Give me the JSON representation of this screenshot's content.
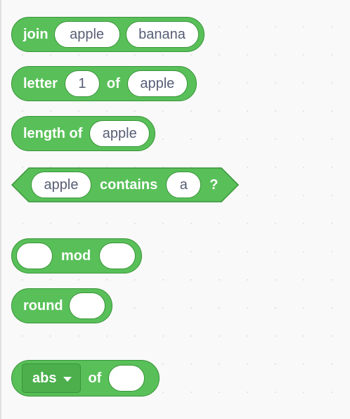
{
  "blocks": {
    "join": {
      "label": "join",
      "input1": "apple",
      "input2": "banana"
    },
    "letter": {
      "label": "letter",
      "index": "1",
      "of": "of",
      "word": "apple"
    },
    "length": {
      "label": "length of",
      "word": "apple"
    },
    "contains": {
      "text": "apple",
      "label": "contains",
      "char": "a",
      "q": "?"
    },
    "mod": {
      "label": "mod",
      "left": "",
      "right": ""
    },
    "round": {
      "label": "round",
      "value": ""
    },
    "abs": {
      "op": "abs",
      "of": "of",
      "value": ""
    }
  },
  "colors": {
    "operator_fill": "#59c059",
    "operator_stroke": "#389438",
    "input_text": "#575e75",
    "background": "#f9f9f9"
  }
}
